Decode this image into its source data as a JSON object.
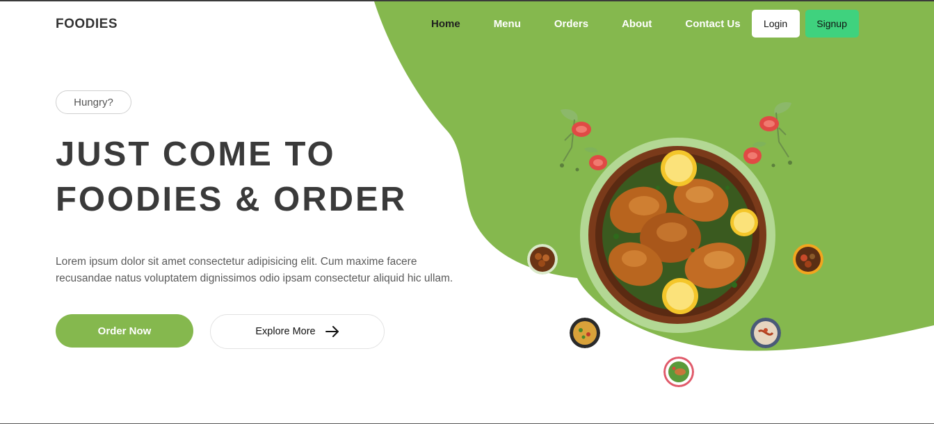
{
  "brand": "FOODIES",
  "nav": {
    "links": [
      "Home",
      "Menu",
      "Orders",
      "About",
      "Contact Us"
    ],
    "active": "Home",
    "login_label": "Login",
    "signup_label": "Signup"
  },
  "hero": {
    "badge": "Hungry?",
    "headline_line1": "JUST COME TO",
    "headline_line2": "FOODIES & ORDER",
    "description": "Lorem ipsum dolor sit amet consectetur adipisicing elit. Cum maxime facere recusandae natus voluptatem dignissimos odio ipsam consectetur aliquid hic ullam.",
    "order_button": "Order Now",
    "explore_button": "Explore More"
  },
  "colors": {
    "accent_green": "#85b84e",
    "signup_green": "#3fd27e",
    "plate_ring": "#b3d894",
    "text_dark": "#3a3a3a"
  },
  "icons": [
    "arrow-right-icon",
    "tomato-basil-garnish-icon",
    "roast-chicken-plate-image"
  ]
}
